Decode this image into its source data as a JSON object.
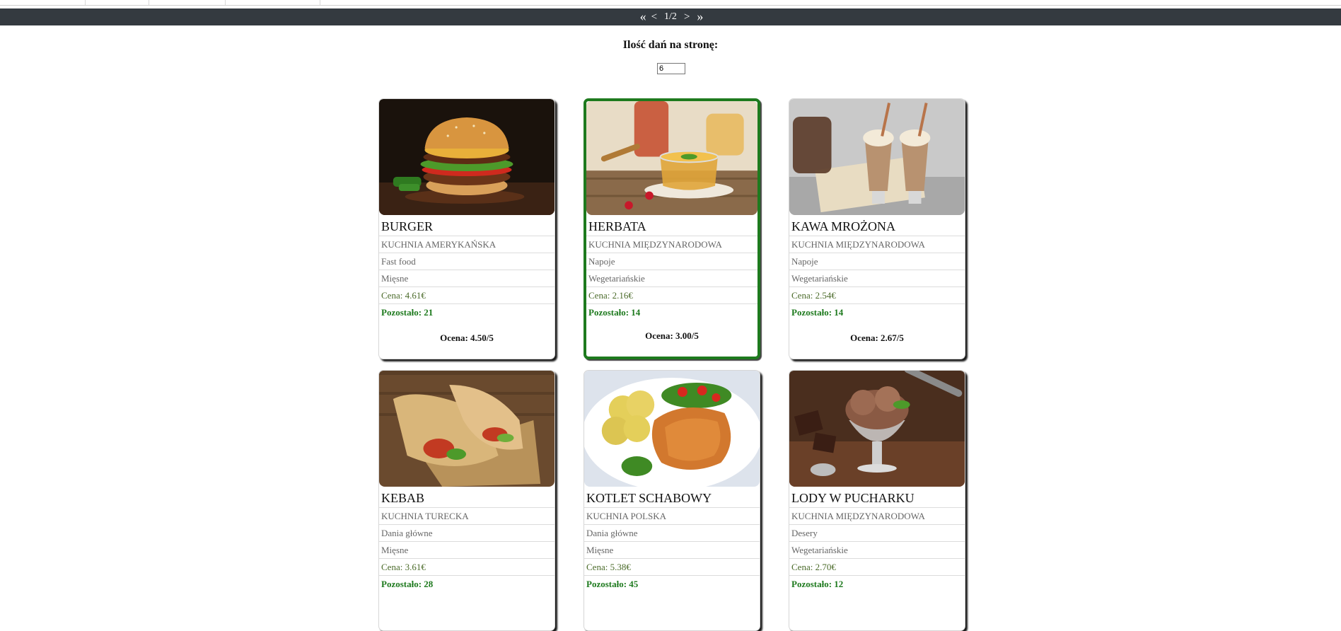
{
  "pager": {
    "first": "«",
    "prev": "<",
    "page": "1/2",
    "next": ">",
    "last": "»"
  },
  "per_page": {
    "label": "Ilość dań na stronę:",
    "value": "6"
  },
  "dishes": [
    {
      "name": "BURGER",
      "cuisine": "KUCHNIA AMERYKAŃSKA",
      "category": "Fast food",
      "type": "Mięsne",
      "price": "Cena: 4.61€",
      "left": "Pozostało: 21",
      "rating": "Ocena: 4.50/5",
      "image": "burger-photo"
    },
    {
      "name": "HERBATA",
      "cuisine": "KUCHNIA MIĘDZYNARODOWA",
      "category": "Napoje",
      "type": "Wegetariańskie",
      "price": "Cena: 2.16€",
      "left": "Pozostało: 14",
      "rating": "Ocena: 3.00/5",
      "image": "tea-photo"
    },
    {
      "name": "KAWA MROŻONA",
      "cuisine": "KUCHNIA MIĘDZYNARODOWA",
      "category": "Napoje",
      "type": "Wegetariańskie",
      "price": "Cena: 2.54€",
      "left": "Pozostało: 14",
      "rating": "Ocena: 2.67/5",
      "image": "iced-coffee-photo"
    },
    {
      "name": "KEBAB",
      "cuisine": "KUCHNIA TURECKA",
      "category": "Dania główne",
      "type": "Mięsne",
      "price": "Cena: 3.61€",
      "left": "Pozostało: 28",
      "image": "kebab-photo"
    },
    {
      "name": "KOTLET SCHABOWY",
      "cuisine": "KUCHNIA POLSKA",
      "category": "Dania główne",
      "type": "Mięsne",
      "price": "Cena: 5.38€",
      "left": "Pozostało: 45",
      "image": "pork-cutlet-photo"
    },
    {
      "name": "LODY W PUCHARKU",
      "cuisine": "KUCHNIA MIĘDZYNARODOWA",
      "category": "Desery",
      "type": "Wegetariańskie",
      "price": "Cena: 2.70€",
      "left": "Pozostało: 12",
      "image": "ice-cream-photo"
    }
  ],
  "colors": {
    "pager_bg": "#343a40",
    "selected_border": "#1e7a1e",
    "available": "#1e7a1e",
    "price": "#4b6b2a"
  }
}
